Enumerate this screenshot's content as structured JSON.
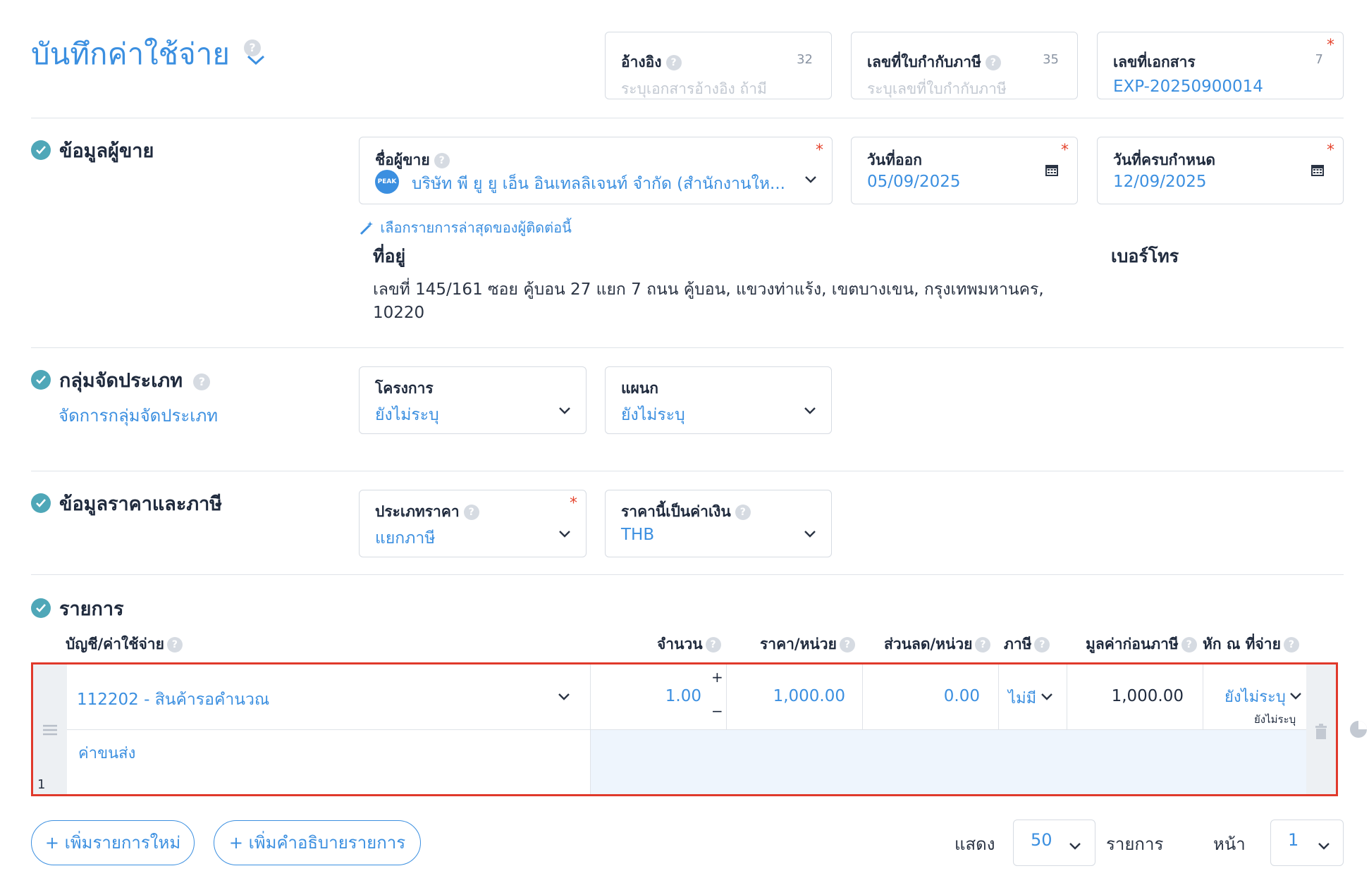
{
  "page": {
    "title": "บันทึกค่าใช้จ่าย"
  },
  "header_fields": {
    "reference": {
      "label": "อ้างอิง",
      "count": "32",
      "placeholder": "ระบุเอกสารอ้างอิง ถ้ามี"
    },
    "tax_invoice": {
      "label": "เลขที่ใบกำกับภาษี",
      "count": "35",
      "placeholder": "ระบุเลขที่ใบกำกับภาษี"
    },
    "document_no": {
      "label": "เลขที่เอกสาร",
      "count": "7",
      "value": "EXP-20250900014"
    }
  },
  "vendor_section": {
    "title": "ข้อมูลผู้ขาย",
    "vendor_name": {
      "label": "ชื่อผู้ขาย",
      "logo_text": "PEAK",
      "value": "บริษัท พี ยู ยู เอ็น อินเทลลิเจนท์ จำกัด (สำนักงานให..."
    },
    "issue_date": {
      "label": "วันที่ออก",
      "value": "05/09/2025"
    },
    "due_date": {
      "label": "วันที่ครบกำหนด",
      "value": "12/09/2025"
    },
    "recent_link": "เลือกรายการล่าสุดของผู้ติดต่อนี้",
    "address_label": "ที่อยู่",
    "address_line1": "เลขที่ 145/161 ซอย คู้บอน 27 แยก 7 ถนน คู้บอน, แขวงท่าแร้ง, เขตบางเขน, กรุงเทพมหานคร,",
    "address_line2": "10220",
    "phone_label": "เบอร์โทร"
  },
  "classification_section": {
    "title": "กลุ่มจัดประเภท",
    "manage_link": "จัดการกลุ่มจัดประเภท",
    "project": {
      "label": "โครงการ",
      "value": "ยังไม่ระบุ"
    },
    "department": {
      "label": "แผนก",
      "value": "ยังไม่ระบุ"
    }
  },
  "price_section": {
    "title": "ข้อมูลราคาและภาษี",
    "price_type": {
      "label": "ประเภทราคา",
      "value": "แยกภาษี"
    },
    "currency": {
      "label": "ราคานี้เป็นค่าเงิน",
      "value": "THB"
    }
  },
  "items_section": {
    "title": "รายการ",
    "columns": {
      "account": "บัญชี/ค่าใช้จ่าย",
      "quantity": "จำนวน",
      "unit_price": "ราคา/หน่วย",
      "discount": "ส่วนลด/หน่วย",
      "tax": "ภาษี",
      "pre_tax": "มูลค่าก่อนภาษี",
      "withholding": "หัก ณ ที่จ่าย"
    },
    "rows": [
      {
        "index": "1",
        "account": "112202 - สินค้ารอคำนวณ",
        "quantity": "1.00",
        "unit_price": "1,000.00",
        "discount": "0.00",
        "tax": "ไม่มี",
        "pre_tax": "1,000.00",
        "withholding": "ยังไม่ระบุ",
        "withholding_sub": "ยังไม่ระบุ",
        "description": "ค่าขนส่ง"
      }
    ],
    "add_item_button": "เพิ่มรายการใหม่",
    "add_description_button": "เพิ่มคำอธิบายรายการ",
    "pagination": {
      "show_label": "แสดง",
      "page_size": "50",
      "items_label": "รายการ",
      "page_label": "หน้า",
      "page": "1"
    }
  },
  "colors": {
    "accent": "#3b8fe0",
    "highlight_border": "#e0392b",
    "check": "#4fa7b8"
  }
}
